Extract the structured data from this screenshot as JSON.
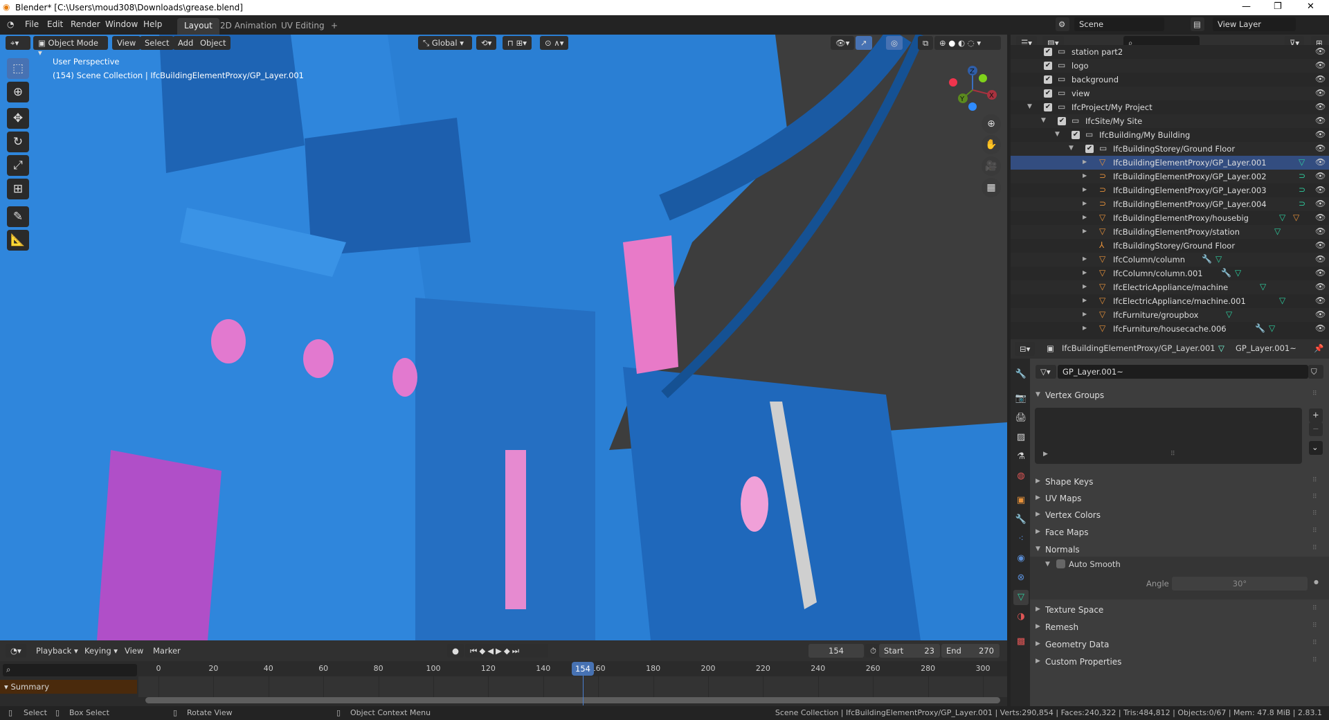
{
  "window": {
    "title": "Blender* [C:\\Users\\moud308\\Downloads\\grease.blend]",
    "minimize": "—",
    "maximize": "❐",
    "close": "✕"
  },
  "menu": [
    "File",
    "Edit",
    "Render",
    "Window",
    "Help"
  ],
  "workspaces": [
    {
      "label": "Layout",
      "active": true
    },
    {
      "label": "2D Animation"
    },
    {
      "label": "UV Editing"
    },
    {
      "label": "+"
    }
  ],
  "topbar": {
    "scene": "Scene",
    "view_layer": "View Layer"
  },
  "viewport": {
    "mode": "Object Mode",
    "menus": [
      "View",
      "Select",
      "Add",
      "Object"
    ],
    "orientation": "Global",
    "overlay_title": "User Perspective",
    "overlay_sub": "(154) Scene Collection | IfcBuildingElementProxy/GP_Layer.001",
    "gizmo": {
      "x": "X",
      "y": "Y",
      "z": "Z"
    },
    "accent": "#2d7fd6"
  },
  "outliner": {
    "rows": [
      {
        "label": "station part2",
        "level": 0,
        "type": "collection"
      },
      {
        "label": "logo",
        "level": 0,
        "type": "collection"
      },
      {
        "label": "background",
        "level": 0,
        "type": "collection"
      },
      {
        "label": "view",
        "level": 0,
        "type": "collection"
      },
      {
        "label": "IfcProject/My Project",
        "level": 0,
        "type": "collection",
        "expanded": true
      },
      {
        "label": "IfcSite/My Site",
        "level": 1,
        "type": "collection",
        "expanded": true
      },
      {
        "label": "IfcBuilding/My Building",
        "level": 2,
        "type": "collection",
        "expanded": true
      },
      {
        "label": "IfcBuildingStorey/Ground Floor",
        "level": 3,
        "type": "collection",
        "expanded": true
      },
      {
        "label": "IfcBuildingElementProxy/GP_Layer.001",
        "level": 4,
        "type": "mesh",
        "extra": [
          "mesh-data"
        ],
        "selected": true
      },
      {
        "label": "IfcBuildingElementProxy/GP_Layer.002",
        "level": 4,
        "type": "curve",
        "extra": [
          "curve-data"
        ]
      },
      {
        "label": "IfcBuildingElementProxy/GP_Layer.003",
        "level": 4,
        "type": "curve",
        "extra": [
          "curve-data"
        ]
      },
      {
        "label": "IfcBuildingElementProxy/GP_Layer.004",
        "level": 4,
        "type": "curve",
        "extra": [
          "curve-data"
        ]
      },
      {
        "label": "IfcBuildingElementProxy/housebig",
        "level": 4,
        "type": "mesh",
        "extra": [
          "mesh-data",
          "mesh"
        ]
      },
      {
        "label": "IfcBuildingElementProxy/station",
        "level": 4,
        "type": "mesh",
        "extra": [
          "mesh-data"
        ]
      },
      {
        "label": "IfcBuildingStorey/Ground Floor",
        "level": 4,
        "type": "empty",
        "extra": []
      },
      {
        "label": "IfcColumn/column",
        "level": 4,
        "type": "mesh",
        "extra": [
          "modifier",
          "mesh-data"
        ]
      },
      {
        "label": "IfcColumn/column.001",
        "level": 4,
        "type": "mesh",
        "extra": [
          "modifier",
          "mesh-data"
        ]
      },
      {
        "label": "IfcElectricAppliance/machine",
        "level": 4,
        "type": "mesh",
        "extra": [
          "mesh-data"
        ]
      },
      {
        "label": "IfcElectricAppliance/machine.001",
        "level": 4,
        "type": "mesh",
        "extra": [
          "mesh-data"
        ]
      },
      {
        "label": "IfcFurniture/groupbox",
        "level": 4,
        "type": "mesh",
        "extra": [
          "mesh-data"
        ]
      },
      {
        "label": "IfcFurniture/housecache.006",
        "level": 4,
        "type": "mesh",
        "extra": [
          "modifier",
          "mesh-data"
        ]
      }
    ]
  },
  "properties": {
    "object": "IfcBuildingElementProxy/GP_Layer.001",
    "data": "GP_Layer.001~",
    "datablock": "GP_Layer.001~",
    "panels": [
      {
        "label": "Vertex Groups",
        "open": true
      },
      {
        "label": "Shape Keys"
      },
      {
        "label": "UV Maps"
      },
      {
        "label": "Vertex Colors"
      },
      {
        "label": "Face Maps"
      },
      {
        "label": "Normals",
        "open": true
      },
      {
        "label": "Texture Space"
      },
      {
        "label": "Remesh"
      },
      {
        "label": "Geometry Data"
      },
      {
        "label": "Custom Properties"
      }
    ],
    "auto_smooth": {
      "label": "Auto Smooth",
      "checked": false
    },
    "angle": {
      "label": "Angle",
      "value": "30°"
    }
  },
  "timeline": {
    "menus": [
      "Playback",
      "Keying",
      "View",
      "Marker"
    ],
    "current": "154",
    "start_label": "Start",
    "start": "23",
    "end_label": "End",
    "end": "270",
    "ticks": [
      "0",
      "20",
      "40",
      "60",
      "80",
      "100",
      "120",
      "140",
      "160",
      "180",
      "200",
      "220",
      "240",
      "260",
      "280",
      "300"
    ],
    "summary": "Summary"
  },
  "status": {
    "select": "Select",
    "box_select": "Box Select",
    "rotate": "Rotate View",
    "context": "Object Context Menu",
    "info": "Scene Collection | IfcBuildingElementProxy/GP_Layer.001 | Verts:290,854 | Faces:240,322 | Tris:484,812 | Objects:0/67 | Mem: 47.8 MiB | 2.83.1"
  }
}
